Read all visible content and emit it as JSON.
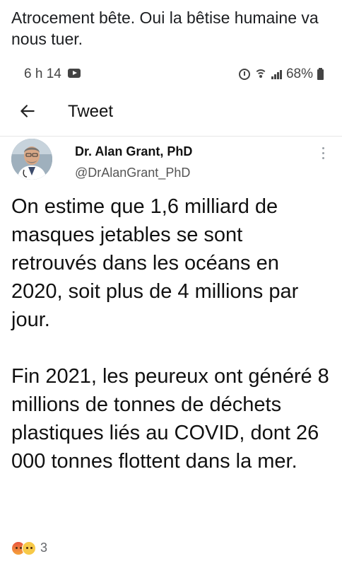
{
  "post": {
    "caption": "Atrocement bête. Oui la bêtise humaine va nous tuer."
  },
  "status_bar": {
    "time": "6 h 14",
    "battery": "68%"
  },
  "header": {
    "title": "Tweet"
  },
  "tweet": {
    "author_name": "Dr. Alan Grant, PhD",
    "handle": "@DrAlanGrant_PhD",
    "paragraphs": [
      "On estime que 1,6 milliard de masques jetables se sont retrouvés dans les océans en 2020, soit plus de 4 millions par jour.",
      "Fin 2021, les peureux ont généré 8 millions de tonnes de déchets plastiques liés au COVID, dont 26 000 tonnes flottent dans la mer."
    ]
  },
  "reactions": {
    "count": "3",
    "types": [
      "angry",
      "sad"
    ]
  },
  "icons": {
    "back": "arrow-left-icon",
    "more": "more-vertical-icon",
    "status": [
      "youtube-icon",
      "alarm-icon",
      "wifi-icon",
      "signal-icon",
      "battery-icon"
    ]
  }
}
